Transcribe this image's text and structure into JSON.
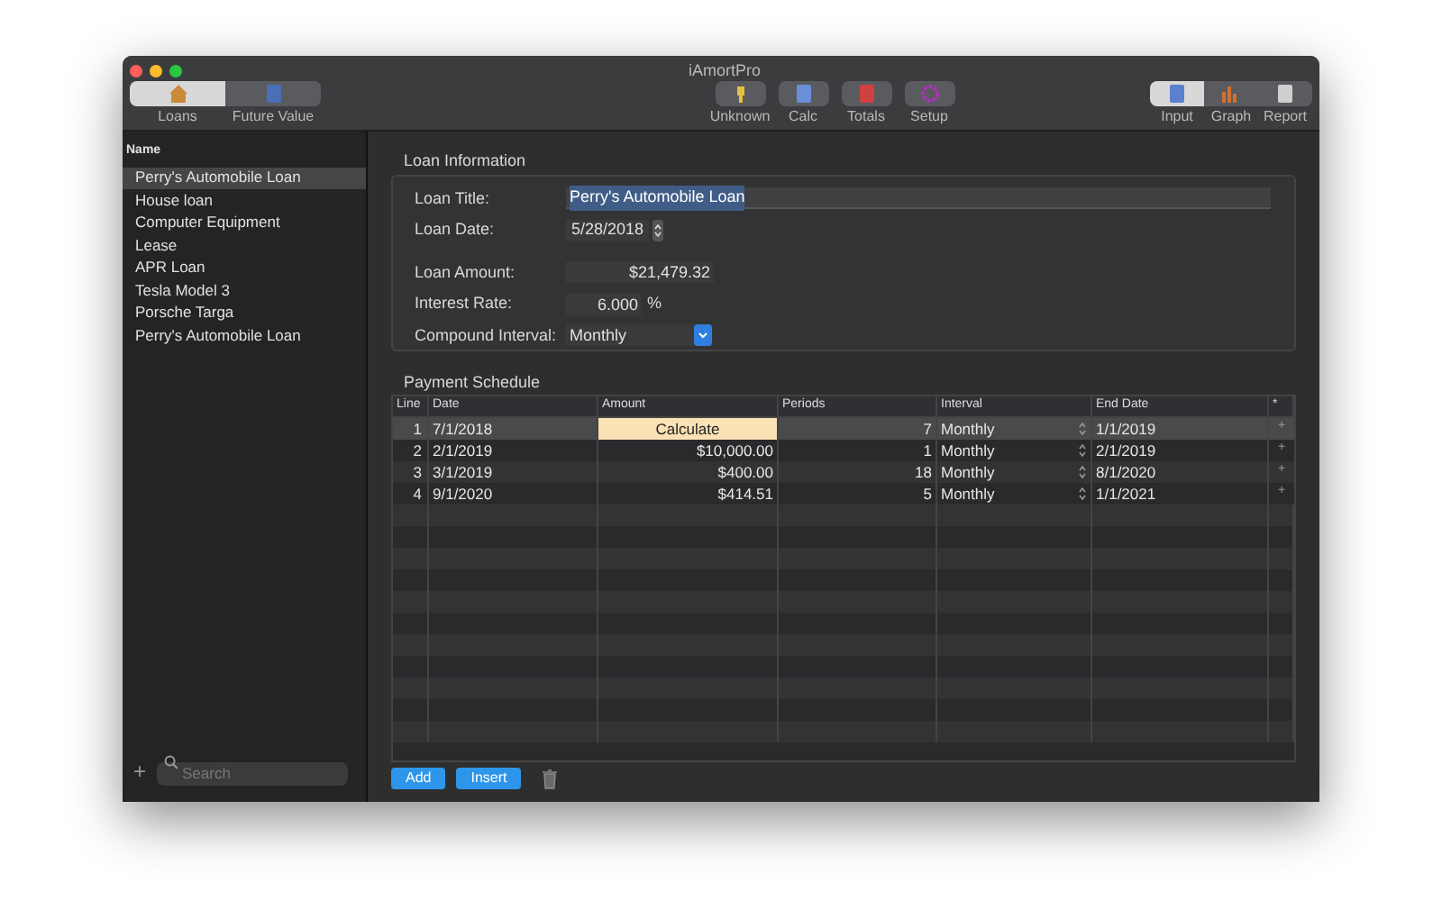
{
  "window": {
    "title": "iAmortPro"
  },
  "toolbar": {
    "view_tabs": [
      {
        "label": "Loans",
        "selected": true
      },
      {
        "label": "Future Value",
        "selected": false
      }
    ],
    "actions": [
      {
        "label": "Unknown"
      },
      {
        "label": "Calc"
      },
      {
        "label": "Totals"
      },
      {
        "label": "Setup"
      }
    ],
    "mode_tabs": [
      {
        "label": "Input",
        "selected": true
      },
      {
        "label": "Graph",
        "selected": false
      },
      {
        "label": "Report",
        "selected": false
      }
    ]
  },
  "sidebar": {
    "header": "Name",
    "items": [
      {
        "label": "Perry's Automobile Loan",
        "selected": true
      },
      {
        "label": "House loan",
        "selected": false
      },
      {
        "label": "Computer Equipment",
        "selected": false
      },
      {
        "label": "Lease",
        "selected": false
      },
      {
        "label": "APR Loan",
        "selected": false
      },
      {
        "label": "Tesla Model 3",
        "selected": false
      },
      {
        "label": "Porsche Targa",
        "selected": false
      },
      {
        "label": "Perry's Automobile Loan",
        "selected": false
      }
    ],
    "add": "+",
    "search": {
      "placeholder": "Search"
    }
  },
  "loan_information": {
    "title": "Loan Information",
    "loan_title": {
      "label": "Loan Title:",
      "value": "Perry's Automobile Loan"
    },
    "loan_date": {
      "label": "Loan Date:",
      "value": "5/28/2018"
    },
    "loan_amount": {
      "label": "Loan Amount:",
      "value": "$21,479.32"
    },
    "interest_rate": {
      "label": "Interest Rate:",
      "value": "6.000",
      "unit": "%"
    },
    "compound_interval": {
      "label": "Compound Interval:",
      "value": "Monthly"
    }
  },
  "payment_schedule": {
    "title": "Payment Schedule",
    "columns": [
      "Line",
      "Date",
      "Amount",
      "Periods",
      "Interval",
      "End Date",
      "*"
    ],
    "rows": [
      {
        "line": "1",
        "date": "7/1/2018",
        "amount": "Calculate",
        "kind": "button",
        "periods": "7",
        "interval": "Monthly",
        "end_date": "1/1/2019",
        "action": "+",
        "selected": true
      },
      {
        "line": "2",
        "date": "2/1/2019",
        "amount": "$10,000.00",
        "kind": "value",
        "periods": "1",
        "interval": "Monthly",
        "end_date": "2/1/2019",
        "action": "+",
        "selected": false
      },
      {
        "line": "3",
        "date": "3/1/2019",
        "amount": "$400.00",
        "kind": "value",
        "periods": "18",
        "interval": "Monthly",
        "end_date": "8/1/2020",
        "action": "+",
        "selected": false
      },
      {
        "line": "4",
        "date": "9/1/2020",
        "amount": "$414.51",
        "kind": "value",
        "periods": "5",
        "interval": "Monthly",
        "end_date": "1/1/2021",
        "action": "+",
        "selected": false
      }
    ],
    "buttons": [
      "Add",
      "Insert"
    ]
  }
}
